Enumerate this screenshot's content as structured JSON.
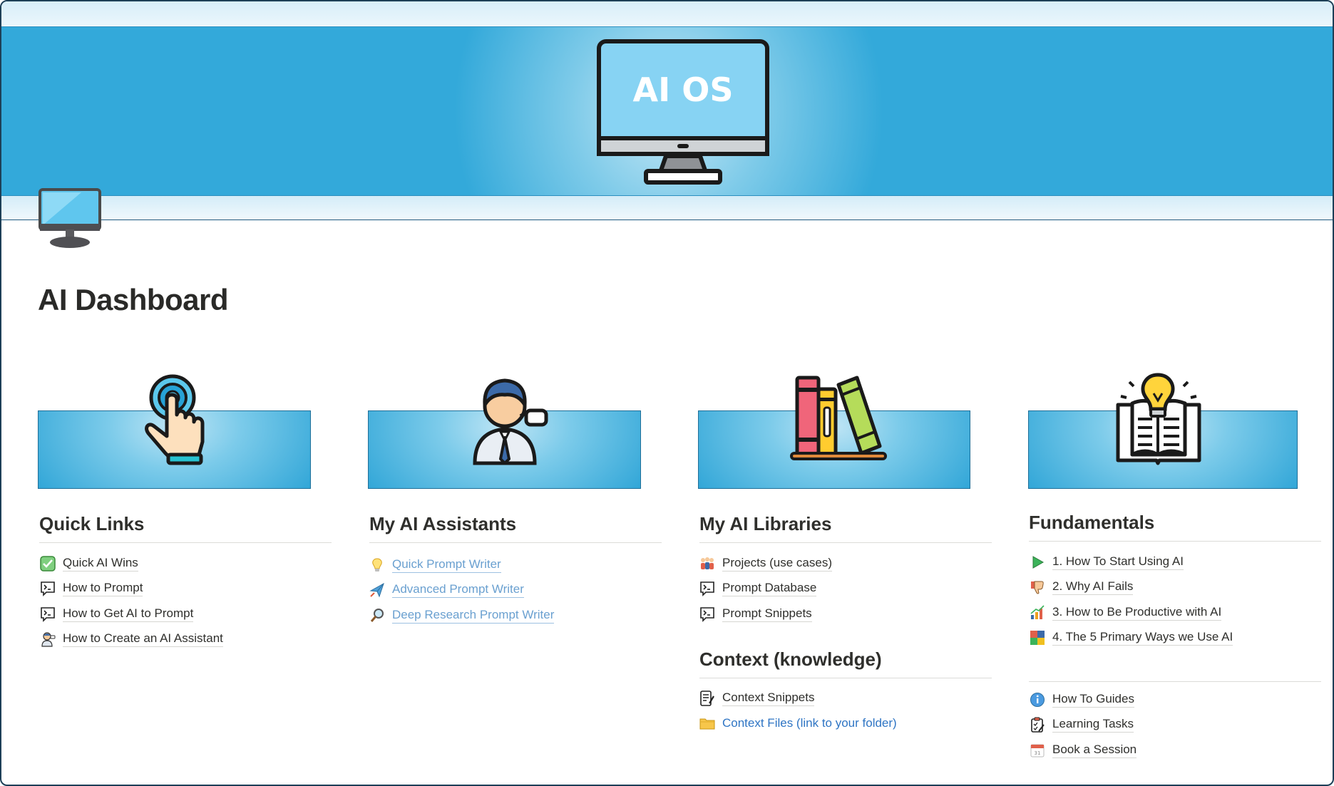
{
  "cover": {
    "screen_text": "AI OS",
    "colors": {
      "band": "#33a9da",
      "screen": "#87d3f3",
      "frame": "#1a1a1a"
    }
  },
  "page": {
    "icon": "monitor-icon",
    "title": "AI Dashboard"
  },
  "columns": [
    {
      "art": "pointer-hand-icon",
      "heading": "Quick Links",
      "items": [
        {
          "icon": "check-icon",
          "label": "Quick AI Wins"
        },
        {
          "icon": "terminal-chat-icon",
          "label": "How to Prompt"
        },
        {
          "icon": "terminal-chat-icon",
          "label": "How to Get AI to Prompt"
        },
        {
          "icon": "assistant-person-icon",
          "label": "How to Create an AI Assistant"
        }
      ]
    },
    {
      "art": "assistant-person-icon",
      "heading": "My AI Assistants",
      "items": [
        {
          "icon": "lightbulb-icon",
          "label": "Quick Prompt Writer"
        },
        {
          "icon": "paper-plane-icon",
          "label": "Advanced Prompt Writer"
        },
        {
          "icon": "magnifier-icon",
          "label": "Deep Research Prompt Writer"
        }
      ]
    },
    {
      "art": "books-icon",
      "heading": "My AI Libraries",
      "items": [
        {
          "icon": "people-icon",
          "label": "Projects (use cases)"
        },
        {
          "icon": "terminal-chat-icon",
          "label": "Prompt Database"
        },
        {
          "icon": "terminal-chat-icon",
          "label": "Prompt Snippets"
        }
      ],
      "heading2": "Context (knowledge)",
      "items2": [
        {
          "icon": "document-edit-icon",
          "label": "Context Snippets"
        },
        {
          "icon": "folder-icon",
          "label": "Context Files (link to your folder)"
        }
      ]
    },
    {
      "art": "book-lightbulb-icon",
      "heading": "Fundamentals",
      "items": [
        {
          "icon": "play-icon",
          "label": "1. How To Start Using AI"
        },
        {
          "icon": "thumbs-down-icon",
          "label": "2. Why AI Fails"
        },
        {
          "icon": "chart-up-icon",
          "label": "3. How to Be Productive with AI"
        },
        {
          "icon": "puzzle-icon",
          "label": "4. The 5 Primary Ways we Use AI"
        }
      ],
      "items2": [
        {
          "icon": "info-icon",
          "label": "How To Guides"
        },
        {
          "icon": "clipboard-icon",
          "label": "Learning Tasks"
        },
        {
          "icon": "calendar-icon",
          "label": "Book a Session"
        }
      ]
    }
  ]
}
